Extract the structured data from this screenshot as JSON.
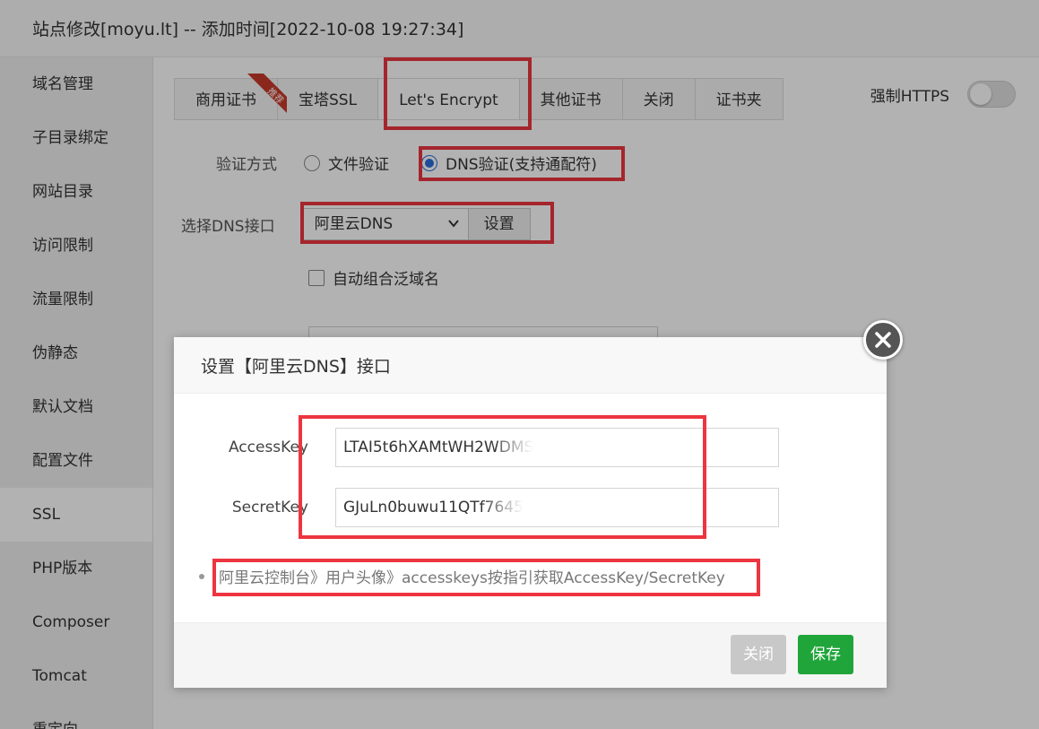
{
  "window": {
    "title": "站点修改[moyu.lt] -- 添加时间[2022-10-08 19:27:34]"
  },
  "sidebar": {
    "items": [
      {
        "label": "域名管理"
      },
      {
        "label": "子目录绑定"
      },
      {
        "label": "网站目录"
      },
      {
        "label": "访问限制"
      },
      {
        "label": "流量限制"
      },
      {
        "label": "伪静态"
      },
      {
        "label": "默认文档"
      },
      {
        "label": "配置文件"
      },
      {
        "label": "SSL"
      },
      {
        "label": "PHP版本"
      },
      {
        "label": "Composer"
      },
      {
        "label": "Tomcat"
      },
      {
        "label": "重定向"
      }
    ],
    "active_index": 8
  },
  "ssl": {
    "tabs": [
      {
        "label": "商用证书"
      },
      {
        "label": "宝塔SSL"
      },
      {
        "label": "Let's Encrypt"
      },
      {
        "label": "其他证书"
      },
      {
        "label": "关闭"
      },
      {
        "label": "证书夹"
      }
    ],
    "active_tab": 2,
    "recommend_badge": "推荐",
    "force_https_label": "强制HTTPS",
    "force_https_on": false,
    "verify_label": "验证方式",
    "verify_file": "文件验证",
    "verify_dns": "DNS验证(支持通配符)",
    "dns_label": "选择DNS接口",
    "dns_selected": "阿里云DNS",
    "dns_setup_button": "设置",
    "auto_wildcard_label": "自动组合泛域名"
  },
  "dialog": {
    "title": "设置【阿里云DNS】接口",
    "access_key_label": "AccessKey",
    "access_key_value": "LTAI5t6hXAMtWH2WDMS",
    "secret_key_label": "SecretKey",
    "secret_key_value": "GJuLn0buwu11QTf7645",
    "tip": "阿里云控制台》用户头像》accesskeys按指引获取AccessKey/SecretKey",
    "close_button": "关闭",
    "save_button": "保存"
  },
  "colors": {
    "highlight_red": "#ec3540",
    "save_green": "#20a53a",
    "radio_blue": "#2a6fdb"
  }
}
